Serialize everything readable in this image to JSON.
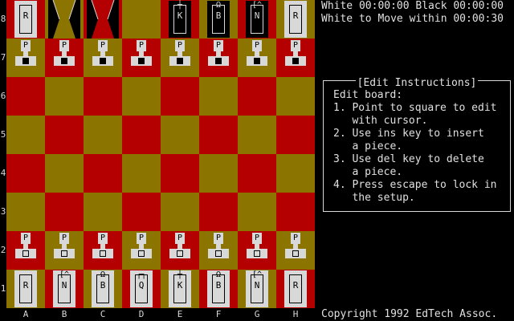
{
  "status": {
    "line1": "White 00:00:00 Black 00:00:00",
    "line2": "White to Move within 00:00:30"
  },
  "edit_panel": {
    "title": "[Edit Instructions]",
    "lines": [
      "Edit board:",
      "1. Point to square to edit",
      "   with cursor.",
      "2. Use ins key to insert",
      "   a piece.",
      "3. Use del key to delete",
      "   a piece.",
      "4. Press escape to lock in",
      "   the setup."
    ]
  },
  "copyright": "Copyright 1992 EdTech Assoc.",
  "board": {
    "ranks": [
      "8",
      "7",
      "6",
      "5",
      "4",
      "3",
      "2",
      "1"
    ],
    "files": [
      "A",
      "B",
      "C",
      "D",
      "E",
      "F",
      "G",
      "H"
    ],
    "colors": {
      "light": "#b40000",
      "dark": "#8c7400"
    },
    "pieces": [
      {
        "square": "a8",
        "color": "black",
        "type": "R"
      },
      {
        "square": "b8",
        "color": "black",
        "type": "?"
      },
      {
        "square": "c8",
        "color": "black",
        "type": "?"
      },
      {
        "square": "e8",
        "color": "black",
        "type": "K"
      },
      {
        "square": "f8",
        "color": "black",
        "type": "B"
      },
      {
        "square": "g8",
        "color": "black",
        "type": "N"
      },
      {
        "square": "h8",
        "color": "black",
        "type": "R"
      },
      {
        "square": "a7",
        "color": "black",
        "type": "P"
      },
      {
        "square": "b7",
        "color": "black",
        "type": "P"
      },
      {
        "square": "c7",
        "color": "black",
        "type": "P"
      },
      {
        "square": "d7",
        "color": "black",
        "type": "P"
      },
      {
        "square": "e7",
        "color": "black",
        "type": "P"
      },
      {
        "square": "f7",
        "color": "black",
        "type": "P"
      },
      {
        "square": "g7",
        "color": "black",
        "type": "P"
      },
      {
        "square": "h7",
        "color": "black",
        "type": "P"
      },
      {
        "square": "a2",
        "color": "white",
        "type": "P"
      },
      {
        "square": "b2",
        "color": "white",
        "type": "P"
      },
      {
        "square": "c2",
        "color": "white",
        "type": "P"
      },
      {
        "square": "d2",
        "color": "white",
        "type": "P"
      },
      {
        "square": "e2",
        "color": "white",
        "type": "P"
      },
      {
        "square": "f2",
        "color": "white",
        "type": "P"
      },
      {
        "square": "g2",
        "color": "white",
        "type": "P"
      },
      {
        "square": "h2",
        "color": "white",
        "type": "P"
      },
      {
        "square": "a1",
        "color": "white",
        "type": "R"
      },
      {
        "square": "b1",
        "color": "white",
        "type": "N"
      },
      {
        "square": "c1",
        "color": "white",
        "type": "B"
      },
      {
        "square": "d1",
        "color": "white",
        "type": "Q"
      },
      {
        "square": "e1",
        "color": "white",
        "type": "K"
      },
      {
        "square": "f1",
        "color": "white",
        "type": "B"
      },
      {
        "square": "g1",
        "color": "white",
        "type": "N"
      },
      {
        "square": "h1",
        "color": "white",
        "type": "R"
      }
    ]
  }
}
